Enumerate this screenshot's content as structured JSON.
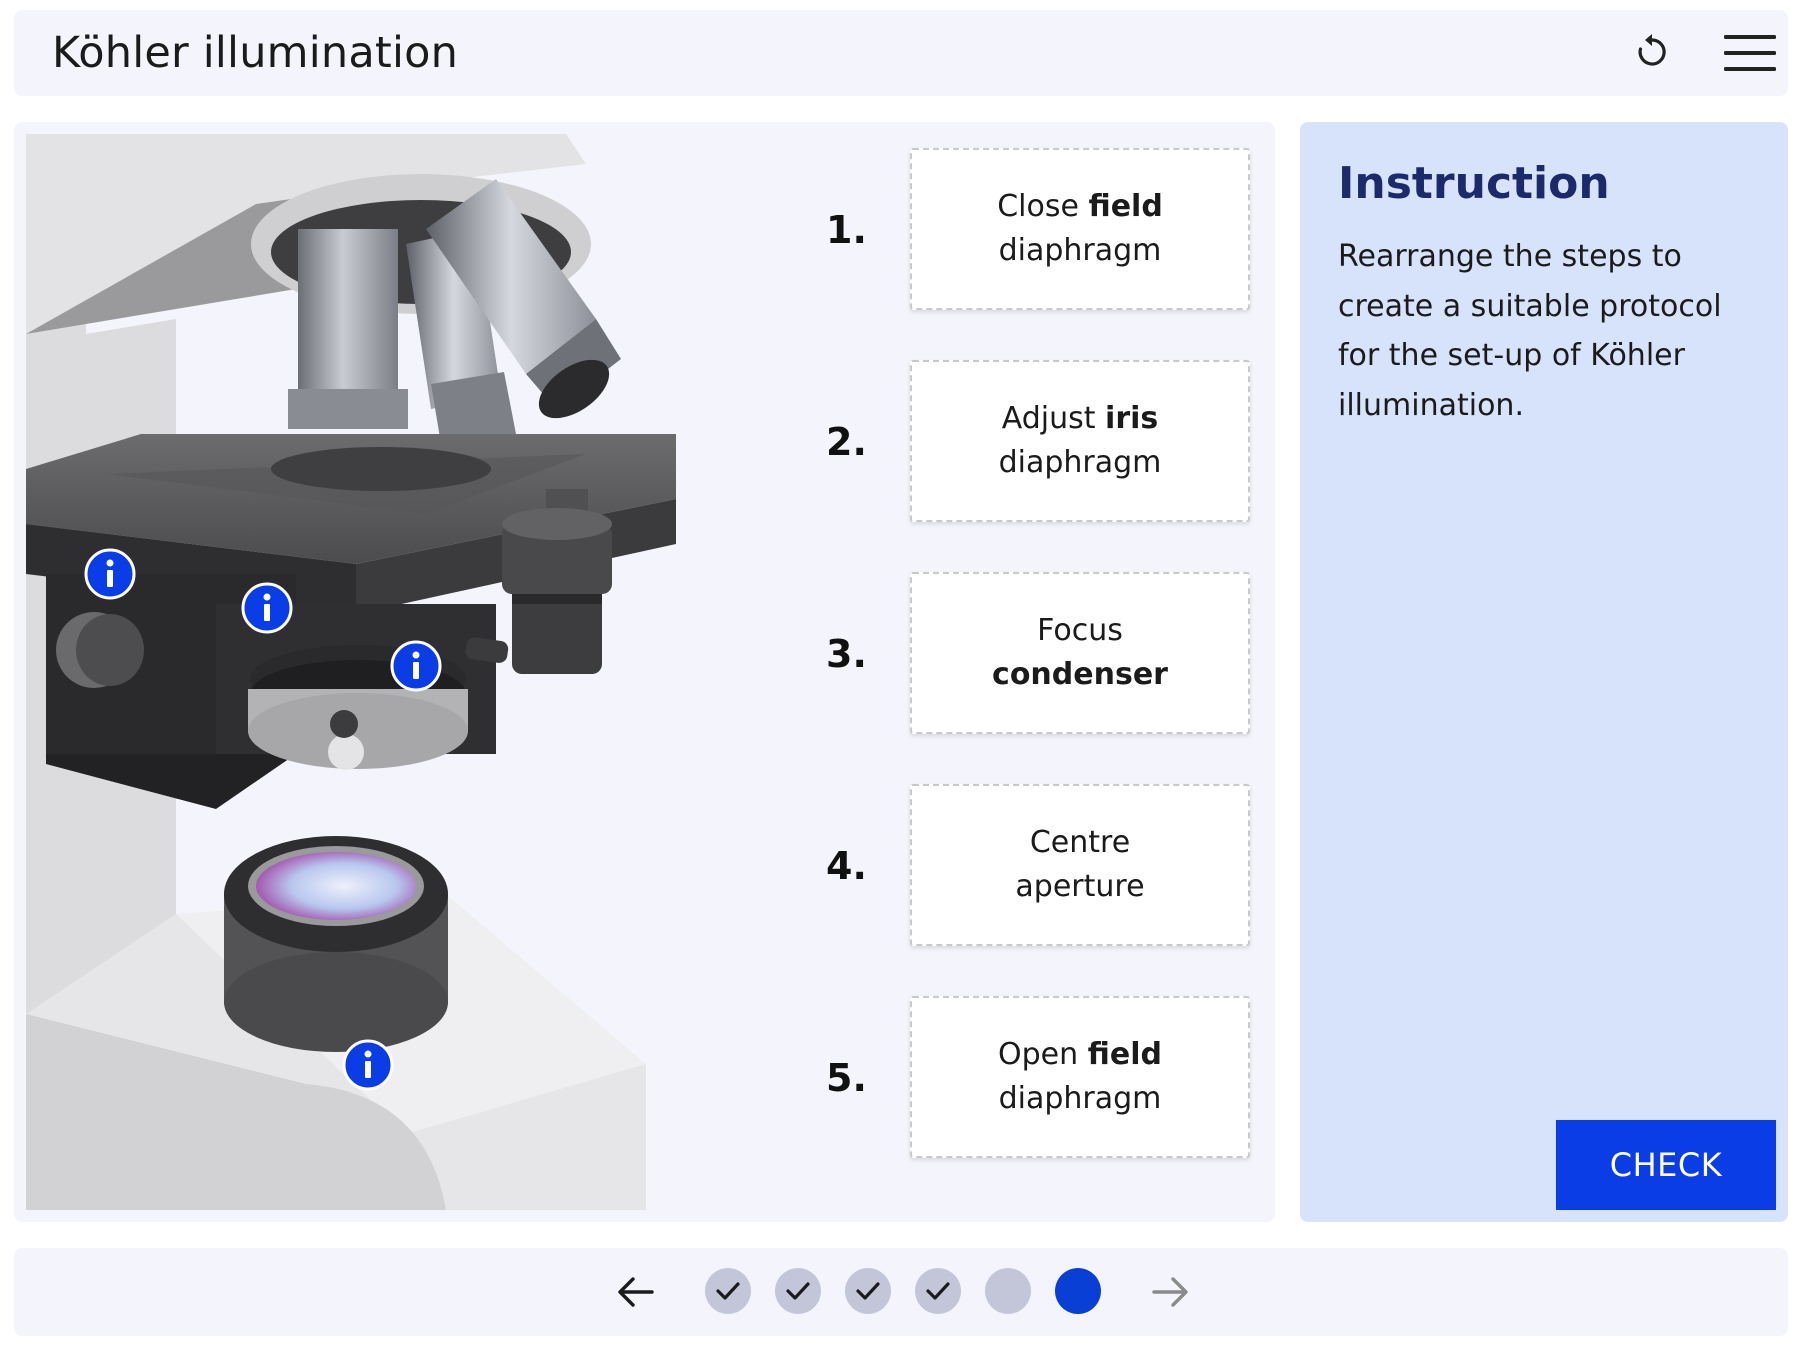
{
  "header": {
    "title": "Köhler illumination",
    "reset_icon": "reset-icon",
    "menu_icon": "hamburger-menu-icon"
  },
  "steps": [
    {
      "number": "1.",
      "parts": [
        {
          "text": "Close ",
          "bold": false
        },
        {
          "text": "field",
          "bold": true
        }
      ],
      "line2": [
        {
          "text": "diaphragm",
          "bold": false
        }
      ]
    },
    {
      "number": "2.",
      "parts": [
        {
          "text": "Adjust ",
          "bold": false
        },
        {
          "text": "iris",
          "bold": true
        }
      ],
      "line2": [
        {
          "text": "diaphragm",
          "bold": false
        }
      ]
    },
    {
      "number": "3.",
      "parts": [
        {
          "text": "Focus",
          "bold": false
        }
      ],
      "line2": [
        {
          "text": "condenser",
          "bold": true
        }
      ]
    },
    {
      "number": "4.",
      "parts": [
        {
          "text": "Centre",
          "bold": false
        }
      ],
      "line2": [
        {
          "text": "aperture",
          "bold": false
        }
      ]
    },
    {
      "number": "5.",
      "parts": [
        {
          "text": "Open ",
          "bold": false
        },
        {
          "text": "field",
          "bold": true
        }
      ],
      "line2": [
        {
          "text": "diaphragm",
          "bold": false
        }
      ]
    }
  ],
  "info_hotspots": [
    "info-icon",
    "info-icon",
    "info-icon",
    "info-icon"
  ],
  "instruction": {
    "heading": "Instruction",
    "text": "Rearrange the steps to create a suitable protocol for the set-up of Köhler illumination.",
    "check_label": "CHECK"
  },
  "colors": {
    "accent": "#0a3de6",
    "panel": "#d7e3fb",
    "heading": "#1c2a6b",
    "dot_done": "#c3c6d9",
    "dot_current": "#0a3fd6"
  },
  "pagination": {
    "prev_icon": "arrow-left-icon",
    "next_icon": "arrow-right-icon",
    "pages": [
      {
        "state": "completed"
      },
      {
        "state": "completed"
      },
      {
        "state": "completed"
      },
      {
        "state": "completed"
      },
      {
        "state": "not-completed"
      },
      {
        "state": "current"
      }
    ]
  }
}
